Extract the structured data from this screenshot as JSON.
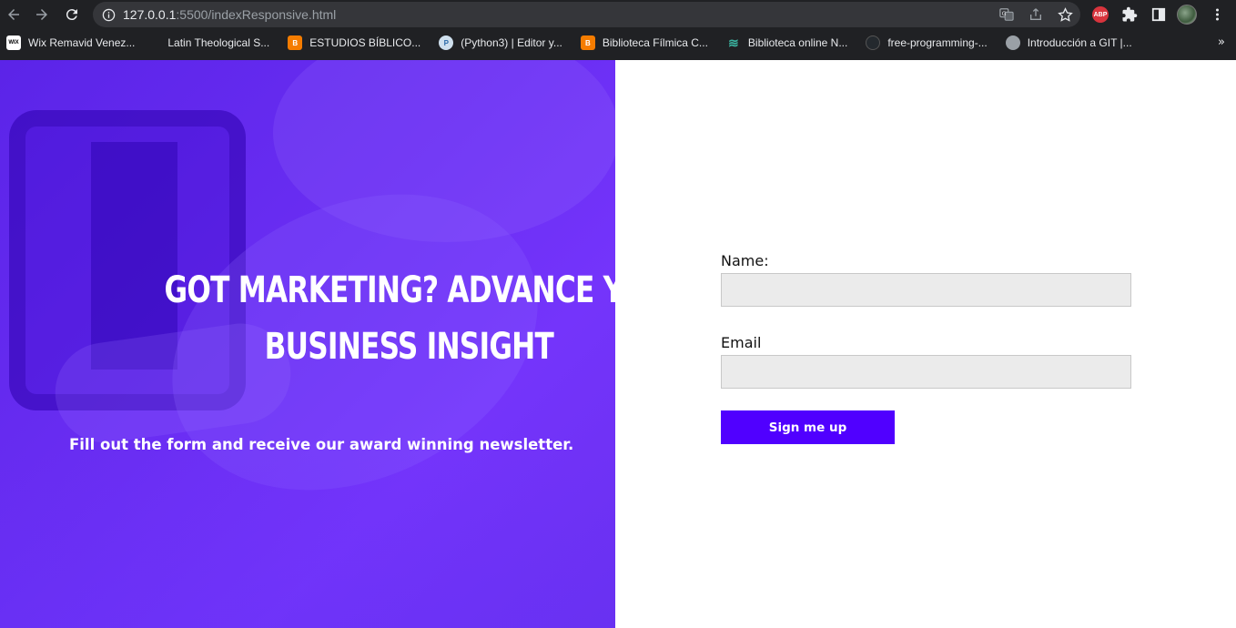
{
  "browser": {
    "url_host": "127.0.0.1",
    "url_path": ":5500/indexResponsive.html",
    "extension_abp": "ABP",
    "bookmarks": [
      {
        "label": "Wix Remavid Venez...",
        "icon": "wix-icon",
        "fav": "WIX"
      },
      {
        "label": "Latin Theological S...",
        "icon": "blank-icon",
        "fav": ""
      },
      {
        "label": "ESTUDIOS BÍBLICO...",
        "icon": "blogger-icon",
        "fav": "B"
      },
      {
        "label": "(Python3) | Editor y...",
        "icon": "python-icon",
        "fav": "P"
      },
      {
        "label": "Biblioteca Fílmica C...",
        "icon": "blogger-icon",
        "fav": "B"
      },
      {
        "label": "Biblioteca online N...",
        "icon": "books-icon",
        "fav": "≋"
      },
      {
        "label": "free-programming-...",
        "icon": "github-icon",
        "fav": ""
      },
      {
        "label": "Introducción a GIT |...",
        "icon": "globe-icon",
        "fav": ""
      }
    ],
    "bookmarks_overflow": "»"
  },
  "hero": {
    "headline_line1": "Got marketing? Advance your",
    "headline_line2": "business insight",
    "subtext": "Fill out the form and receive our award winning newsletter."
  },
  "form": {
    "name_label": "Name:",
    "name_value": "",
    "email_label": "Email",
    "email_value": "",
    "submit_label": "Sign me up"
  },
  "colors": {
    "hero_purple": "#6a2ef3",
    "button": "#5000ff",
    "field_bg": "#ebebeb"
  }
}
